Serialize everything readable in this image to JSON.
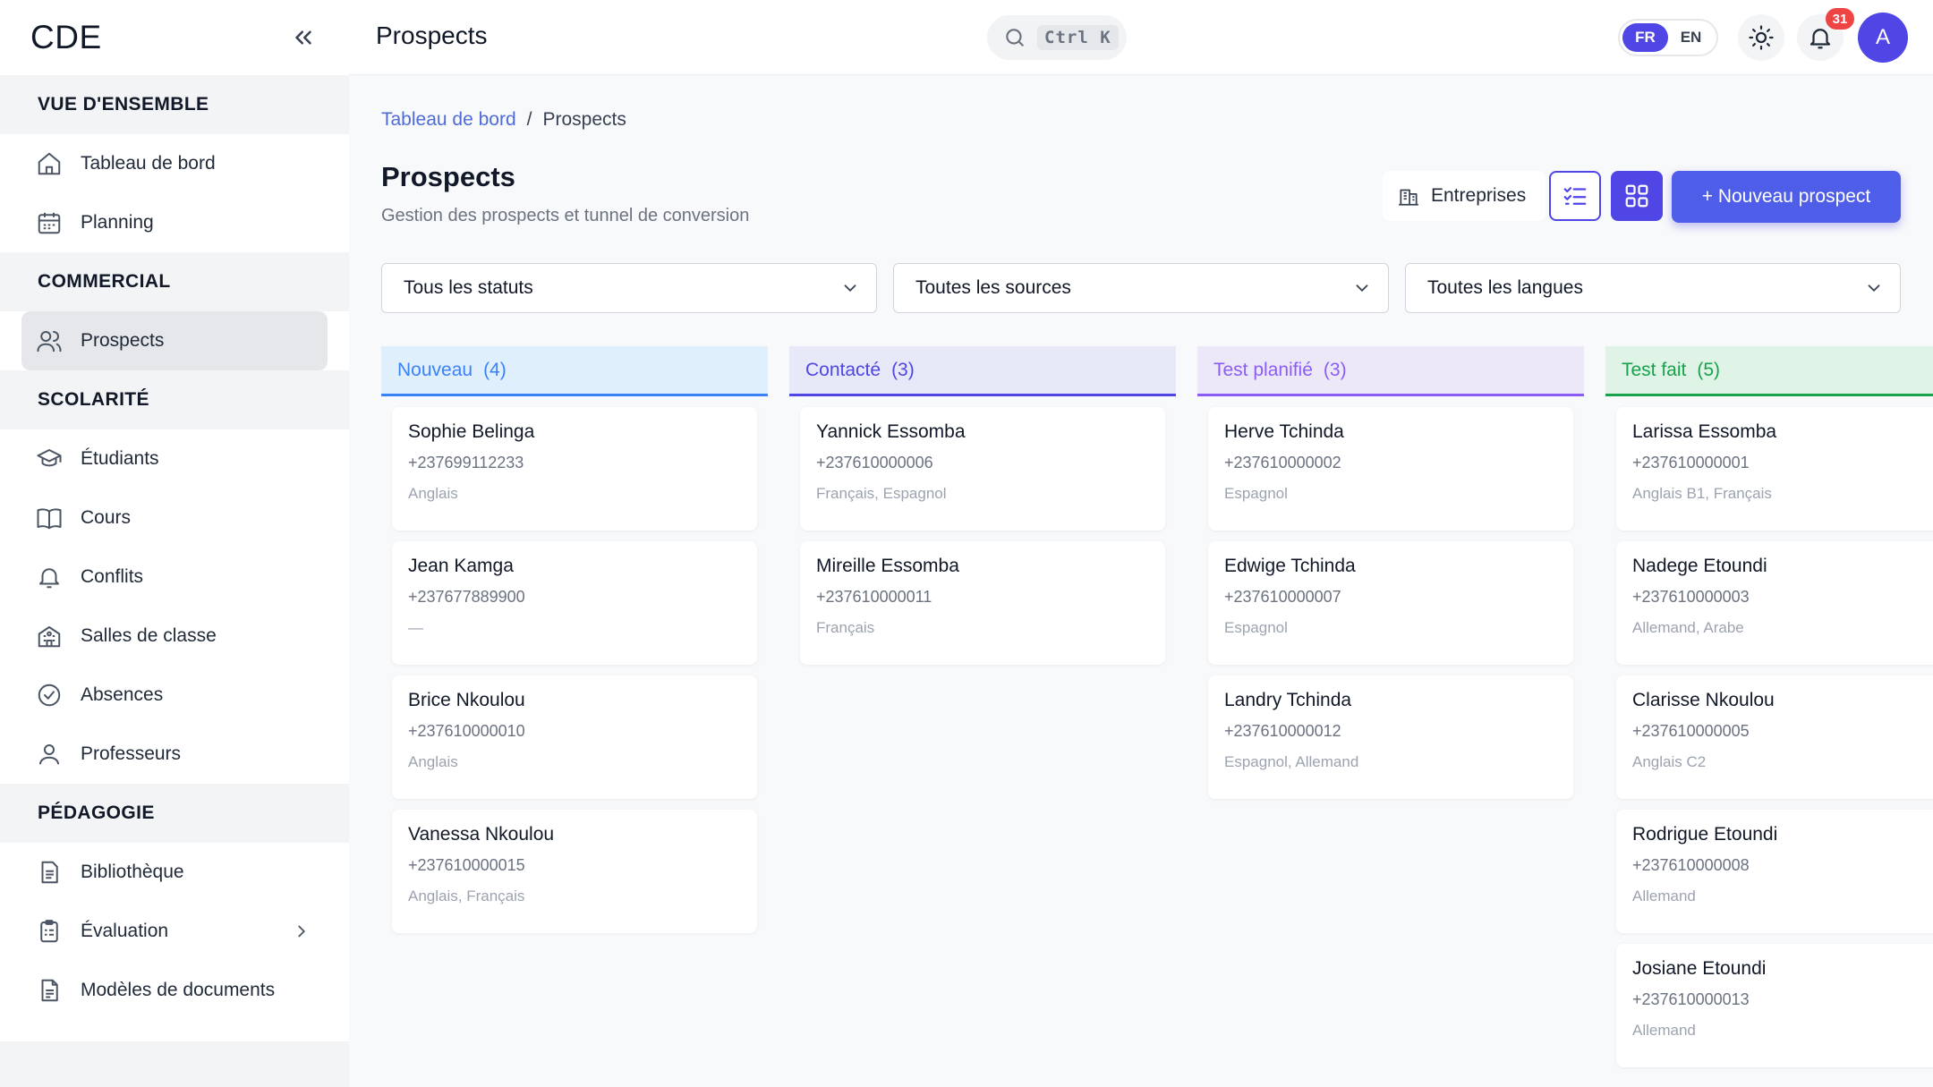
{
  "app": {
    "brand": "CDE"
  },
  "sidebar": {
    "sections": [
      {
        "title": "VUE D'ENSEMBLE",
        "items": [
          {
            "label": "Tableau de bord",
            "icon": "home-icon"
          },
          {
            "label": "Planning",
            "icon": "calendar-icon"
          }
        ]
      },
      {
        "title": "COMMERCIAL",
        "items": [
          {
            "label": "Prospects",
            "icon": "users-icon",
            "active": true
          }
        ]
      },
      {
        "title": "SCOLARITÉ",
        "items": [
          {
            "label": "Étudiants",
            "icon": "graduation-cap-icon"
          },
          {
            "label": "Cours",
            "icon": "book-icon"
          },
          {
            "label": "Conflits",
            "icon": "bell-icon"
          },
          {
            "label": "Salles de classe",
            "icon": "school-icon"
          },
          {
            "label": "Absences",
            "icon": "check-circle-icon"
          },
          {
            "label": "Professeurs",
            "icon": "user-icon"
          }
        ]
      },
      {
        "title": "PÉDAGOGIE",
        "items": [
          {
            "label": "Bibliothèque",
            "icon": "document-icon"
          },
          {
            "label": "Évaluation",
            "icon": "clipboard-icon",
            "has_submenu": true
          },
          {
            "label": "Modèles de documents",
            "icon": "file-text-icon"
          }
        ]
      }
    ]
  },
  "header": {
    "title": "Prospects",
    "search_shortcut": "Ctrl K",
    "languages": [
      "FR",
      "EN"
    ],
    "active_language": "FR",
    "notification_count": "31",
    "avatar_initial": "A"
  },
  "breadcrumb": {
    "home": "Tableau de bord",
    "separator": "/",
    "current": "Prospects"
  },
  "page": {
    "title": "Prospects",
    "subtitle": "Gestion des prospects et tunnel de conversion",
    "companies_button": "Entreprises",
    "new_button": "+ Nouveau prospect"
  },
  "filters": [
    "Tous les statuts",
    "Toutes les sources",
    "Toutes les langues"
  ],
  "colors": {
    "accent": "#4f46e5"
  },
  "columns": [
    {
      "title": "Nouveau",
      "count": "(4)",
      "color": "#3b82f6",
      "bg": "#e0effc",
      "cards": [
        {
          "name": "Sophie Belinga",
          "phone": "+237699112233",
          "langs": "Anglais"
        },
        {
          "name": "Jean Kamga",
          "phone": "+237677889900",
          "langs": "—"
        },
        {
          "name": "Brice Nkoulou",
          "phone": "+237610000010",
          "langs": "Anglais"
        },
        {
          "name": "Vanessa Nkoulou",
          "phone": "+237610000015",
          "langs": "Anglais, Français"
        }
      ]
    },
    {
      "title": "Contacté",
      "count": "(3)",
      "color": "#4f46e5",
      "bg": "#e7e8f8",
      "cards": [
        {
          "name": "Yannick Essomba",
          "phone": "+237610000006",
          "langs": "Français, Espagnol"
        },
        {
          "name": "Mireille Essomba",
          "phone": "+237610000011",
          "langs": "Français"
        }
      ]
    },
    {
      "title": "Test planifié",
      "count": "(3)",
      "color": "#8b5cf6",
      "bg": "#ede8f8",
      "cards": [
        {
          "name": "Herve Tchinda",
          "phone": "+237610000002",
          "langs": "Espagnol"
        },
        {
          "name": "Edwige Tchinda",
          "phone": "+237610000007",
          "langs": "Espagnol"
        },
        {
          "name": "Landry Tchinda",
          "phone": "+237610000012",
          "langs": "Espagnol, Allemand"
        }
      ]
    },
    {
      "title": "Test fait",
      "count": "(5)",
      "color": "#16a34a",
      "bg": "#dff3e6",
      "cards": [
        {
          "name": "Larissa Essomba",
          "phone": "+237610000001",
          "langs": "Anglais B1, Français"
        },
        {
          "name": "Nadege Etoundi",
          "phone": "+237610000003",
          "langs": "Allemand, Arabe"
        },
        {
          "name": "Clarisse Nkoulou",
          "phone": "+237610000005",
          "langs": "Anglais C2"
        },
        {
          "name": "Rodrigue Etoundi",
          "phone": "+237610000008",
          "langs": "Allemand"
        },
        {
          "name": "Josiane Etoundi",
          "phone": "+237610000013",
          "langs": "Allemand"
        }
      ]
    }
  ]
}
